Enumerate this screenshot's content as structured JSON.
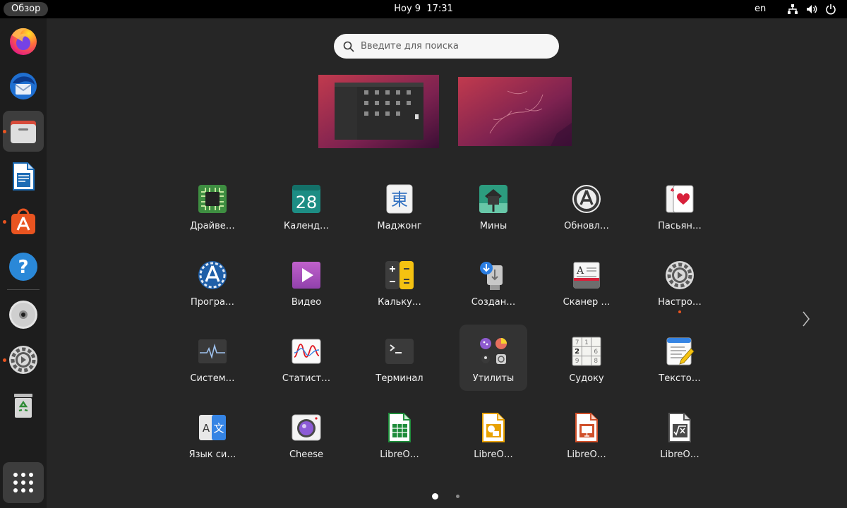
{
  "topbar": {
    "activities": "Обзор",
    "date": "Ноу 9",
    "time": "17:31",
    "keyboard_layout": "en",
    "icons": [
      "network-icon",
      "volume-icon",
      "power-icon"
    ]
  },
  "dock": {
    "items": [
      {
        "name": "firefox",
        "icon": "firefox-icon",
        "running": false,
        "active": false
      },
      {
        "name": "thunderbird",
        "icon": "thunderbird-icon",
        "running": false,
        "active": false
      },
      {
        "name": "files",
        "icon": "files-icon",
        "running": true,
        "active": true
      },
      {
        "name": "libreoffice-writer",
        "icon": "writer-icon",
        "running": false,
        "active": false
      },
      {
        "name": "ubuntu-software",
        "icon": "software-icon",
        "running": true,
        "active": false
      },
      {
        "name": "help",
        "icon": "help-icon",
        "running": false,
        "active": false
      },
      {
        "name": "dvd-drive",
        "icon": "dvd-icon",
        "running": false,
        "active": false
      },
      {
        "name": "settings",
        "icon": "settings-icon",
        "running": true,
        "active": false
      },
      {
        "name": "trash",
        "icon": "trash-icon",
        "running": false,
        "active": false
      }
    ],
    "show_apps_icon": "app-grid-icon"
  },
  "search": {
    "placeholder": "Введите для поиска",
    "value": ""
  },
  "workspaces": [
    {
      "index": 1,
      "has_window": true
    },
    {
      "index": 2,
      "has_window": false
    }
  ],
  "apps": [
    {
      "label": "Драйве…",
      "icon": "chip-icon"
    },
    {
      "label": "Календ…",
      "icon": "calendar-icon",
      "calendar_day": "28"
    },
    {
      "label": "Маджонг",
      "icon": "mahjong-icon",
      "glyph": "東"
    },
    {
      "label": "Мины",
      "icon": "mines-icon"
    },
    {
      "label": "Обновл…",
      "icon": "software-updater-icon"
    },
    {
      "label": "Пасьян…",
      "icon": "solitaire-icon"
    },
    {
      "label": "Програ…",
      "icon": "software-properties-icon"
    },
    {
      "label": "Видео",
      "icon": "video-icon"
    },
    {
      "label": "Кальку…",
      "icon": "calculator-icon"
    },
    {
      "label": "Создан…",
      "icon": "usb-creator-icon"
    },
    {
      "label": "Сканер …",
      "icon": "scanner-icon"
    },
    {
      "label": "Настро…",
      "icon": "settings-icon",
      "running": true
    },
    {
      "label": "Систем…",
      "icon": "system-monitor-icon"
    },
    {
      "label": "Статист…",
      "icon": "power-statistics-icon"
    },
    {
      "label": "Терминал",
      "icon": "terminal-icon"
    },
    {
      "label": "Утилиты",
      "icon": "utilities-folder-icon",
      "hover": true
    },
    {
      "label": "Судоку",
      "icon": "sudoku-icon"
    },
    {
      "label": "Тексто…",
      "icon": "text-editor-icon"
    },
    {
      "label": "Язык си…",
      "icon": "language-icon"
    },
    {
      "label": "Cheese",
      "icon": "cheese-icon"
    },
    {
      "label": "LibreO…",
      "icon": "libreoffice-calc-icon"
    },
    {
      "label": "LibreO…",
      "icon": "libreoffice-draw-icon"
    },
    {
      "label": "LibreO…",
      "icon": "libreoffice-impress-icon"
    },
    {
      "label": "LibreO…",
      "icon": "libreoffice-math-icon"
    }
  ],
  "pagination": {
    "pages": 2,
    "current": 1,
    "next_icon": "chevron-right-icon"
  },
  "colors": {
    "accent": "#e95420",
    "background": "#262626",
    "dock": "#1d1d1d",
    "topbar": "#000000"
  }
}
